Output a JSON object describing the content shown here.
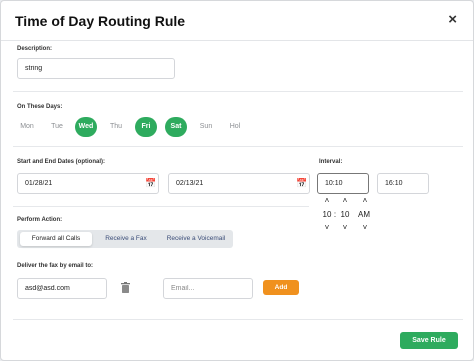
{
  "title": "Time of Day Routing Rule",
  "close_icon": "×",
  "description": {
    "label": "Description:",
    "value": "string"
  },
  "days": {
    "label": "On These Days:",
    "items": [
      {
        "label": "Mon",
        "selected": false
      },
      {
        "label": "Tue",
        "selected": false
      },
      {
        "label": "Wed",
        "selected": true
      },
      {
        "label": "Thu",
        "selected": false
      },
      {
        "label": "Fri",
        "selected": true
      },
      {
        "label": "Sat",
        "selected": true
      },
      {
        "label": "Sun",
        "selected": false
      },
      {
        "label": "Hol",
        "selected": false
      }
    ]
  },
  "dates": {
    "label": "Start and End Dates (optional):",
    "start": "01/28/21",
    "end": "02/13/21"
  },
  "interval": {
    "label": "Interval:",
    "start": "10:10",
    "end": "16:10",
    "picker": {
      "hour": "10",
      "separator": ":",
      "minute": "10",
      "ampm": "AM"
    }
  },
  "action": {
    "label": "Perform Action:",
    "options": [
      "Forward all Calls",
      "Receive a Fax",
      "Receive a Voicemail"
    ],
    "active": "Forward all Calls"
  },
  "fax": {
    "label": "Deliver the fax by email to:",
    "email_value": "asd@asd.com",
    "email_placeholder": "Email...",
    "add_label": "Add"
  },
  "save_label": "Save Rule",
  "colors": {
    "accent_green": "#2eab5e",
    "accent_orange": "#f0911e"
  }
}
